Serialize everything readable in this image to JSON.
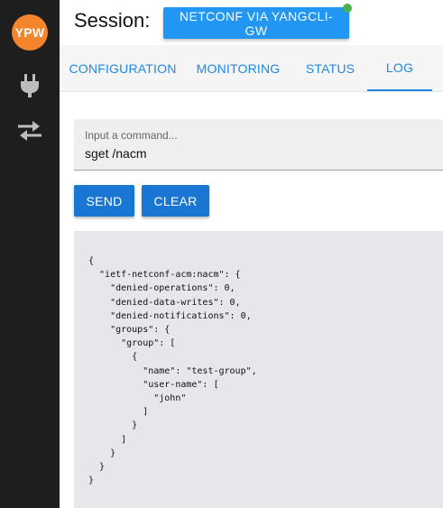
{
  "sidebar": {
    "logo_text": "YPW",
    "logo_color": "#f5852d",
    "items": [
      {
        "icon": "plug-icon"
      },
      {
        "icon": "swap-arrows-icon"
      }
    ]
  },
  "session": {
    "label": "Session:",
    "button_label": "NETCONF VIA YANGCLI-GW",
    "status_color": "#4caf50"
  },
  "tabs": [
    {
      "label": "CONFIGURATION",
      "active": false
    },
    {
      "label": "MONITORING",
      "active": false
    },
    {
      "label": "STATUS",
      "active": false
    },
    {
      "label": "LOG",
      "active": true
    }
  ],
  "command": {
    "placeholder": "Input a command...",
    "value": "sget /nacm"
  },
  "actions": {
    "send_label": "SEND",
    "clear_label": "CLEAR"
  },
  "output": {
    "text": "{\n  \"ietf-netconf-acm:nacm\": {\n    \"denied-operations\": 0,\n    \"denied-data-writes\": 0,\n    \"denied-notifications\": 0,\n    \"groups\": {\n      \"group\": [\n        {\n          \"name\": \"test-group\",\n          \"user-name\": [\n            \"john\"\n          ]\n        }\n      ]\n    }\n  }\n}"
  },
  "colors": {
    "accent": "#1e88e5",
    "button": "#1976d2",
    "sidebar": "#1e1e1e"
  }
}
